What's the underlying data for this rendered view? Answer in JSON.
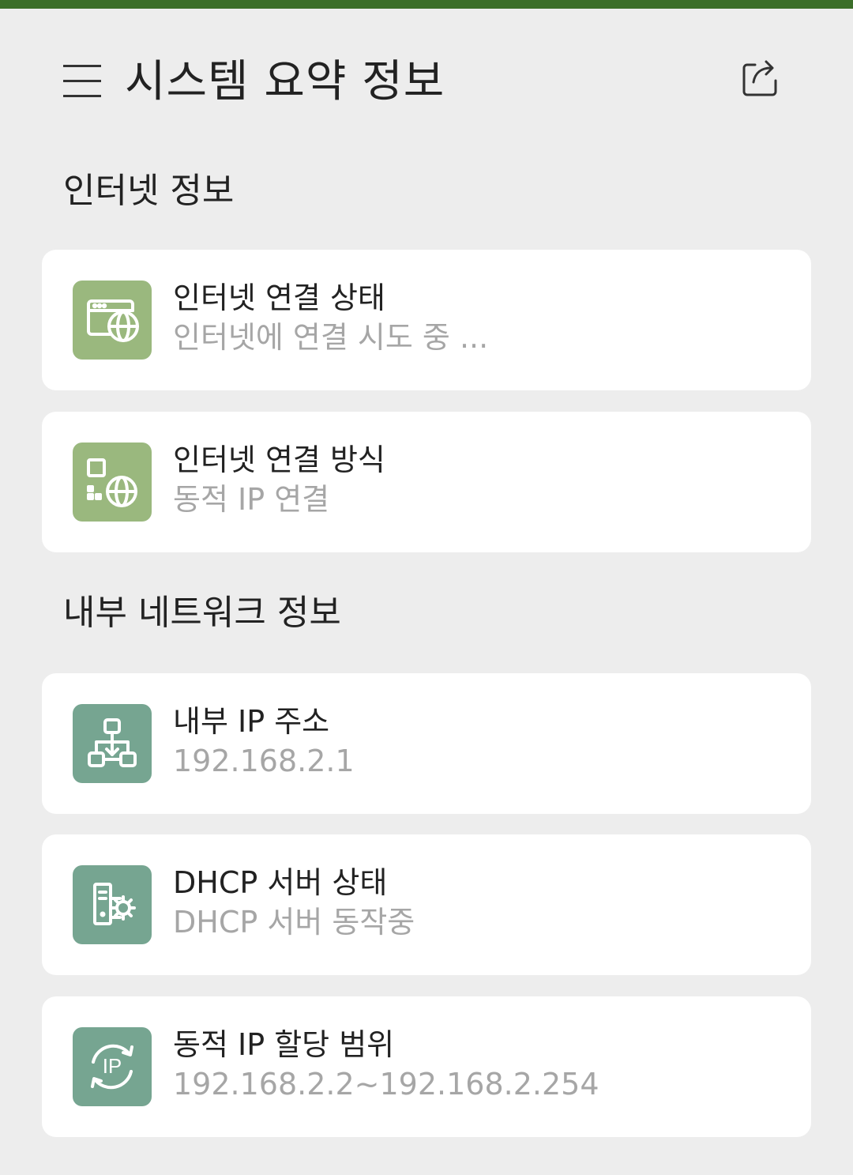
{
  "header": {
    "title": "시스템 요약 정보",
    "menu_icon": "hamburger-menu-icon",
    "share_icon": "share-export-icon",
    "accent_color": "#3b6e29"
  },
  "sections": {
    "internet": {
      "title": "인터넷 정보",
      "items": [
        {
          "title": "인터넷 연결 상태",
          "value": "인터넷에 연결 시도 중 ...",
          "icon": "browser-globe-icon"
        },
        {
          "title": "인터넷 연결 방식",
          "value": "동적 IP 연결",
          "icon": "device-globe-icon"
        }
      ]
    },
    "internal": {
      "title": "내부 네트워크 정보",
      "items": [
        {
          "title": "내부 IP 주소",
          "value": "192.168.2.1",
          "icon": "network-hierarchy-icon"
        },
        {
          "title": "DHCP 서버 상태",
          "value": "DHCP 서버 동작중",
          "icon": "server-gear-icon"
        },
        {
          "title": "동적 IP 할당 범위",
          "value": "192.168.2.2~192.168.2.254",
          "icon": "ip-cycle-icon"
        }
      ]
    }
  },
  "colors": {
    "internet_icon_bg": "#9ab87e",
    "network_icon_bg": "#76a591",
    "background": "#ededed",
    "card": "#ffffff",
    "secondary_text": "#a6a6a6"
  }
}
